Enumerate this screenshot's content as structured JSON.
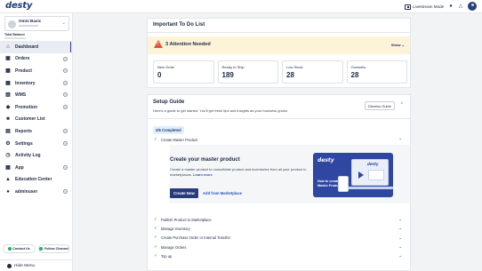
{
  "app": {
    "logo": "desty"
  },
  "topbar": {
    "livestream_label": "Livestream Mode",
    "chat_icon": "chat-icon",
    "bell_icon": "bell-icon"
  },
  "sidebar": {
    "store_name": "Omni Basic",
    "total_balance_label": "Total Balance",
    "items": [
      {
        "label": "Dashboard",
        "icon": "home-icon",
        "expandable": false,
        "active": true
      },
      {
        "label": "Orders",
        "icon": "orders-icon",
        "expandable": true
      },
      {
        "label": "Product",
        "icon": "product-icon",
        "expandable": true
      },
      {
        "label": "Inventory",
        "icon": "inventory-icon",
        "expandable": true
      },
      {
        "label": "WMS",
        "icon": "wms-icon",
        "expandable": true
      },
      {
        "label": "Promotion",
        "icon": "promotion-icon",
        "expandable": true
      },
      {
        "label": "Customer List",
        "icon": "customer-icon",
        "expandable": false
      },
      {
        "label": "Reports",
        "icon": "reports-icon",
        "expandable": true
      },
      {
        "label": "Settings",
        "icon": "settings-icon",
        "expandable": true
      },
      {
        "label": "Activity Log",
        "icon": "activity-icon",
        "expandable": false
      },
      {
        "label": "App",
        "icon": "app-icon",
        "expandable": true
      },
      {
        "label": "Education Center",
        "icon": "education-icon",
        "expandable": false
      },
      {
        "label": "adminuser",
        "icon": "user-icon",
        "expandable": true
      }
    ],
    "contact_us": "Contact Us",
    "follow_channel": "Follow Channel",
    "hide_menu": "Hide Menu"
  },
  "todo": {
    "title": "Important To Do List",
    "attention": "3 Attention Needed",
    "show_label": "Show",
    "stats": [
      {
        "label": "New Order",
        "value": "0"
      },
      {
        "label": "Ready to Ship",
        "value": "189"
      },
      {
        "label": "Low Stock",
        "value": "28"
      },
      {
        "label": "Oversells",
        "value": "28"
      }
    ]
  },
  "setup": {
    "title": "Setup Guide",
    "subtitle": "Here's a guide to get started. You'll get fresh tips and insights as your business grows",
    "dismiss": "Dismiss Guide",
    "completed": "2/6 Completed",
    "current_step": "Create Master Product",
    "master_title": "Create your master product",
    "master_desc": "Create a master product to consolidate product and inventories from all your product in marketplaces.",
    "learn_more": "Learn more",
    "create_now": "Create Now",
    "add_from_marketplace": "Add from Marketplace",
    "promo_logo": "desty",
    "promo_text": "How to create a Master Product",
    "steps": [
      "Publish Product to Marketplace",
      "Manage Inventory",
      "Create Purchase Order or Internal Transfer",
      "Manage Orders",
      "Top up"
    ]
  }
}
